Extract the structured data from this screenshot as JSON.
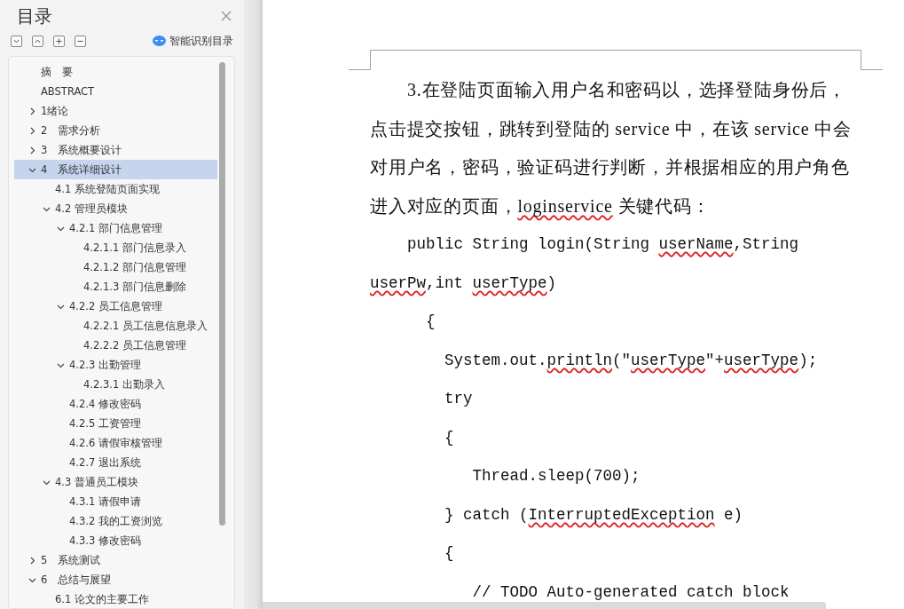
{
  "sidebar": {
    "title": "目录",
    "tools": [
      {
        "kind": "collapse"
      },
      {
        "kind": "expand"
      },
      {
        "kind": "plus"
      },
      {
        "kind": "minus"
      }
    ],
    "smart_button": "智能识别目录",
    "toc": [
      {
        "label": "摘　要",
        "selected": false
      },
      {
        "label": "ABSTRACT",
        "selected": false
      },
      {
        "label": "1绪论",
        "selected": false,
        "expanded": false
      },
      {
        "label": "2　需求分析",
        "selected": false,
        "expanded": false
      },
      {
        "label": "3　系统概要设计",
        "selected": false,
        "expanded": false
      },
      {
        "label": "4　系统详细设计",
        "selected": true,
        "expanded": true,
        "children": [
          {
            "label": "4.1 系统登陆页面实现",
            "selected": false
          },
          {
            "label": "4.2 管理员模块",
            "selected": false,
            "expanded": true,
            "children": [
              {
                "label": "4.2.1 部门信息管理",
                "selected": false,
                "expanded": true,
                "children": [
                  {
                    "label": "4.2.1.1 部门信息录入",
                    "selected": false
                  },
                  {
                    "label": "4.2.1.2 部门信息管理",
                    "selected": false
                  },
                  {
                    "label": "4.2.1.3 部门信息删除",
                    "selected": false
                  }
                ]
              },
              {
                "label": "4.2.2 员工信息管理",
                "selected": false,
                "expanded": true,
                "children": [
                  {
                    "label": "4.2.2.1 员工信息信息录入",
                    "selected": false
                  },
                  {
                    "label": "4.2.2.2 员工信息管理",
                    "selected": false
                  }
                ]
              },
              {
                "label": "4.2.3 出勤管理",
                "selected": false,
                "expanded": true,
                "children": [
                  {
                    "label": "4.2.3.1 出勤录入",
                    "selected": false
                  }
                ]
              },
              {
                "label": "4.2.4 修改密码",
                "selected": false
              },
              {
                "label": "4.2.5 工资管理",
                "selected": false
              },
              {
                "label": "4.2.6 请假审核管理",
                "selected": false
              },
              {
                "label": "4.2.7 退出系统",
                "selected": false
              }
            ]
          },
          {
            "label": "4.3 普通员工模块",
            "selected": false,
            "expanded": true,
            "children": [
              {
                "label": "4.3.1 请假申请",
                "selected": false
              },
              {
                "label": "4.3.2 我的工资浏览",
                "selected": false
              },
              {
                "label": "4.3.3 修改密码",
                "selected": false
              }
            ]
          }
        ]
      },
      {
        "label": "5　系统测试",
        "selected": false,
        "expanded": false
      },
      {
        "label": "6　总结与展望",
        "selected": false,
        "expanded": true,
        "children": [
          {
            "label": "6.1 论文的主要工作",
            "selected": false
          }
        ]
      }
    ]
  },
  "document": {
    "lines": [
      {
        "kind": "prose-first",
        "segments": [
          {
            "text": "3.在登陆页面输入用户名和密码以，选择登陆身份后，",
            "flagged": false
          }
        ]
      },
      {
        "kind": "prose",
        "segments": [
          {
            "text": "点击提交按钮，跳转到登陆的 service 中，在该 service 中会",
            "flagged": false
          }
        ]
      },
      {
        "kind": "prose",
        "segments": [
          {
            "text": "对用户名，密码，验证码进行判断，并根据相应的用户角色",
            "flagged": false
          }
        ]
      },
      {
        "kind": "prose",
        "segments": [
          {
            "text": "进入对应的页面，",
            "flagged": false
          },
          {
            "text": "loginservice",
            "flagged": true
          },
          {
            "text": " 关键代码：",
            "flagged": false
          }
        ]
      },
      {
        "kind": "code",
        "segments": [
          {
            "text": "    public String login(String ",
            "flagged": false
          },
          {
            "text": "userName",
            "flagged": true
          },
          {
            "text": ",String",
            "flagged": false
          }
        ]
      },
      {
        "kind": "code",
        "segments": [
          {
            "text": "userPw",
            "flagged": true
          },
          {
            "text": ",int ",
            "flagged": false
          },
          {
            "text": "userType",
            "flagged": true
          },
          {
            "text": ")",
            "flagged": false
          }
        ]
      },
      {
        "kind": "code",
        "segments": [
          {
            "text": "      {",
            "flagged": false
          }
        ]
      },
      {
        "kind": "code",
        "segments": [
          {
            "text": "        System.out.",
            "flagged": false
          },
          {
            "text": "println",
            "flagged": true
          },
          {
            "text": "(\"",
            "flagged": false
          },
          {
            "text": "userType",
            "flagged": true
          },
          {
            "text": "\"+",
            "flagged": false
          },
          {
            "text": "userType",
            "flagged": true
          },
          {
            "text": ");",
            "flagged": false
          }
        ]
      },
      {
        "kind": "code",
        "segments": [
          {
            "text": "        try",
            "flagged": false
          }
        ]
      },
      {
        "kind": "code",
        "segments": [
          {
            "text": "        {",
            "flagged": false
          }
        ]
      },
      {
        "kind": "code",
        "segments": [
          {
            "text": "           Thread.sleep(700);",
            "flagged": false
          }
        ]
      },
      {
        "kind": "code",
        "segments": [
          {
            "text": "        } catch (",
            "flagged": false
          },
          {
            "text": "InterruptedException",
            "flagged": true
          },
          {
            "text": " e)",
            "flagged": false
          }
        ]
      },
      {
        "kind": "code",
        "segments": [
          {
            "text": "        {",
            "flagged": false
          }
        ]
      },
      {
        "kind": "code",
        "segments": [
          {
            "text": "           // TODO Auto-generated catch block",
            "flagged": false
          }
        ]
      }
    ]
  }
}
